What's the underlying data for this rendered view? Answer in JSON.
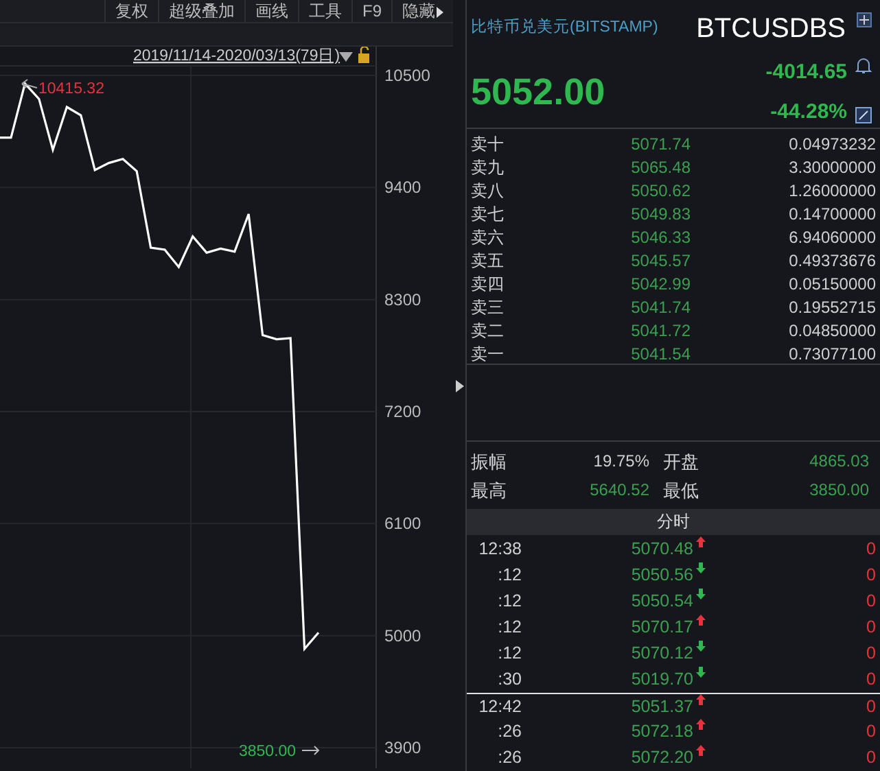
{
  "toolbar": {
    "items": [
      {
        "label": "复权"
      },
      {
        "label": "超级叠加"
      },
      {
        "label": "画线"
      },
      {
        "label": "工具"
      },
      {
        "label": "F9"
      },
      {
        "label": "隐藏"
      }
    ]
  },
  "chart": {
    "range_label": "2019/11/14-2020/03/13(79日)",
    "max_label": "10415.32",
    "min_label": "3850.00",
    "chart_data": {
      "type": "line",
      "grid": true,
      "ylim": [
        3900,
        10500
      ],
      "yticks": [
        3900,
        5000,
        6100,
        7200,
        8300,
        9400,
        10500
      ],
      "series": [
        {
          "color": "#ffffff",
          "values": [
            9890,
            9890,
            10420,
            10270,
            9770,
            10190,
            10110,
            9570,
            9640,
            9680,
            9560,
            8810,
            8790,
            8620,
            8920,
            8760,
            8800,
            8770,
            9140,
            7950,
            7910,
            7920,
            4870,
            5030
          ]
        }
      ]
    }
  },
  "quote": {
    "name": "比特币兑美元(BITSTAMP)",
    "symbol": "BTCUSDBS",
    "price": "5052.00",
    "change": "-4014.65",
    "change_pct": "-44.28%"
  },
  "asks": [
    {
      "label": "卖十",
      "price": "5071.74",
      "volume": "0.04973232"
    },
    {
      "label": "卖九",
      "price": "5065.48",
      "volume": "3.30000000"
    },
    {
      "label": "卖八",
      "price": "5050.62",
      "volume": "1.26000000"
    },
    {
      "label": "卖七",
      "price": "5049.83",
      "volume": "0.14700000"
    },
    {
      "label": "卖六",
      "price": "5046.33",
      "volume": "6.94060000"
    },
    {
      "label": "卖五",
      "price": "5045.57",
      "volume": "0.49373676"
    },
    {
      "label": "卖四",
      "price": "5042.99",
      "volume": "0.05150000"
    },
    {
      "label": "卖三",
      "price": "5041.74",
      "volume": "0.19552715"
    },
    {
      "label": "卖二",
      "price": "5041.72",
      "volume": "0.04850000"
    },
    {
      "label": "卖一",
      "price": "5041.54",
      "volume": "0.73077100"
    }
  ],
  "stats": [
    {
      "label": "振幅",
      "value": "19.75%",
      "color": "#cfd0d4"
    },
    {
      "label": "开盘",
      "value": "4865.03",
      "color": "#3aa04f"
    },
    {
      "label": "最高",
      "value": "5640.52",
      "color": "#3aa04f"
    },
    {
      "label": "最低",
      "value": "3850.00",
      "color": "#3aa04f"
    }
  ],
  "trades_header": "分时",
  "trades": [
    {
      "time": "12:38",
      "price": "5070.48",
      "rising": true,
      "volume": "0",
      "group_start": false
    },
    {
      "time": ":12",
      "price": "5050.56",
      "rising": false,
      "volume": "0",
      "group_start": false
    },
    {
      "time": ":12",
      "price": "5050.54",
      "rising": false,
      "volume": "0",
      "group_start": false
    },
    {
      "time": ":12",
      "price": "5070.17",
      "rising": true,
      "volume": "0",
      "group_start": false
    },
    {
      "time": ":12",
      "price": "5070.12",
      "rising": false,
      "volume": "0",
      "group_start": false
    },
    {
      "time": ":30",
      "price": "5019.70",
      "rising": false,
      "volume": "0",
      "group_start": false
    },
    {
      "time": "12:42",
      "price": "5051.37",
      "rising": true,
      "volume": "0",
      "group_start": true
    },
    {
      "time": ":26",
      "price": "5072.18",
      "rising": true,
      "volume": "0",
      "group_start": false
    },
    {
      "time": ":26",
      "price": "5072.20",
      "rising": true,
      "volume": "0",
      "group_start": false
    }
  ]
}
